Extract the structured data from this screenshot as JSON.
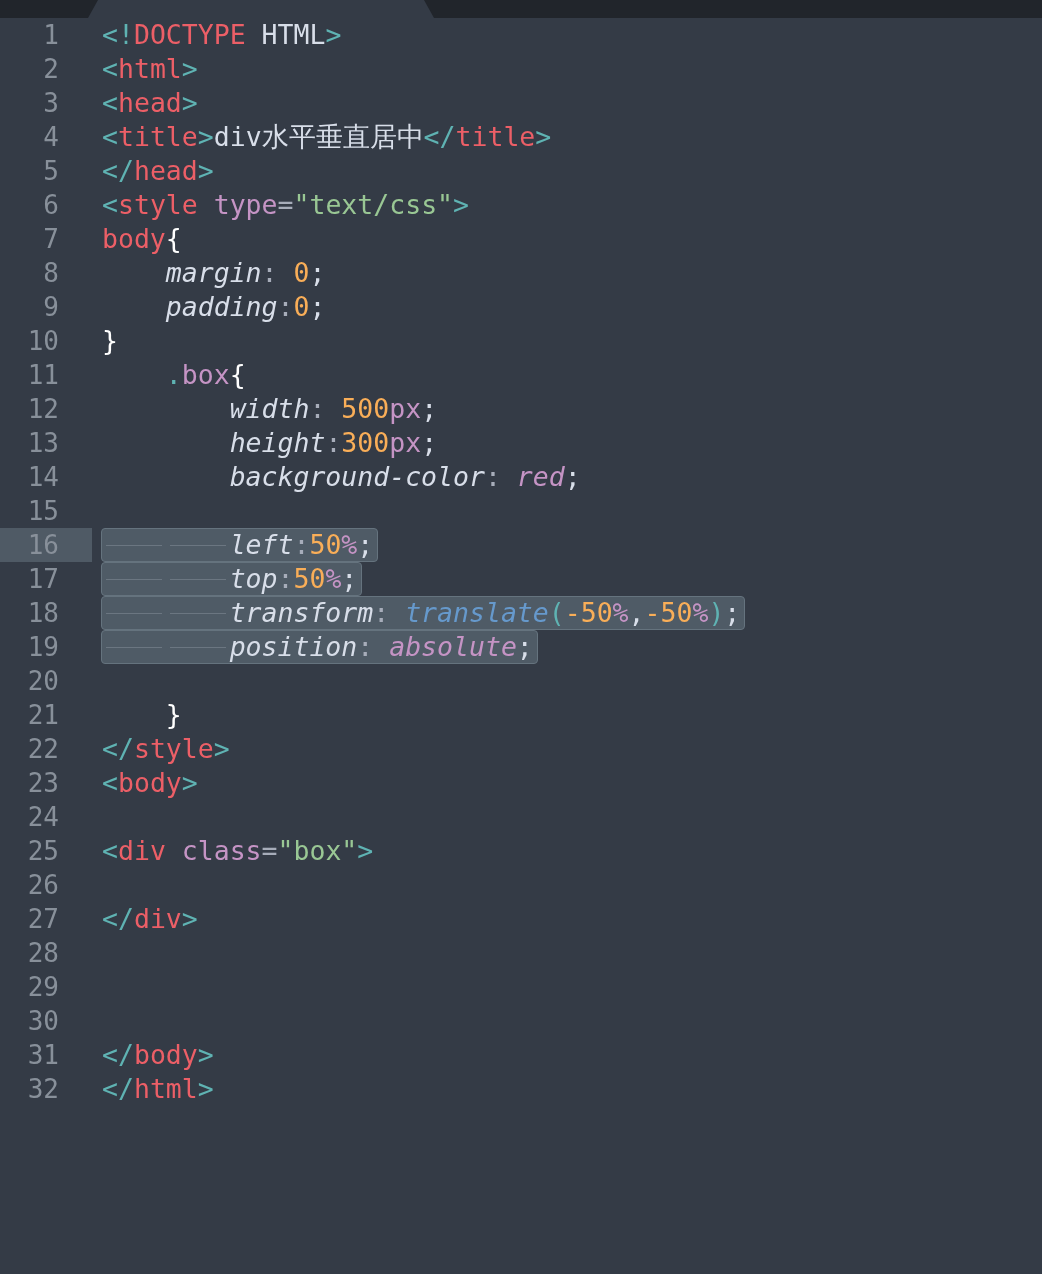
{
  "tab": {
    "selected": true
  },
  "lines": [
    {
      "number": "1",
      "selected": false,
      "current": false,
      "tokens": [
        {
          "text": "<!",
          "kind": "punct"
        },
        {
          "text": "DOCTYPE",
          "kind": "tag"
        },
        {
          "text": " HTML",
          "kind": "plain"
        },
        {
          "text": ">",
          "kind": "punct"
        }
      ]
    },
    {
      "number": "2",
      "selected": false,
      "current": false,
      "tokens": [
        {
          "text": "<",
          "kind": "punct"
        },
        {
          "text": "html",
          "kind": "tag"
        },
        {
          "text": ">",
          "kind": "punct"
        }
      ]
    },
    {
      "number": "3",
      "selected": false,
      "current": false,
      "tokens": [
        {
          "text": "<",
          "kind": "punct"
        },
        {
          "text": "head",
          "kind": "tag"
        },
        {
          "text": ">",
          "kind": "punct"
        }
      ]
    },
    {
      "number": "4",
      "selected": false,
      "current": false,
      "tokens": [
        {
          "text": "<",
          "kind": "punct"
        },
        {
          "text": "title",
          "kind": "tag"
        },
        {
          "text": ">",
          "kind": "punct"
        },
        {
          "text": "div水平垂直居中",
          "kind": "plain"
        },
        {
          "text": "</",
          "kind": "punct"
        },
        {
          "text": "title",
          "kind": "tag"
        },
        {
          "text": ">",
          "kind": "punct"
        }
      ]
    },
    {
      "number": "5",
      "selected": false,
      "current": false,
      "tokens": [
        {
          "text": "</",
          "kind": "punct"
        },
        {
          "text": "head",
          "kind": "tag"
        },
        {
          "text": ">",
          "kind": "punct"
        }
      ]
    },
    {
      "number": "6",
      "selected": false,
      "current": false,
      "tokens": [
        {
          "text": "<",
          "kind": "punct"
        },
        {
          "text": "style",
          "kind": "tag"
        },
        {
          "text": " type",
          "kind": "attr"
        },
        {
          "text": "=",
          "kind": "op"
        },
        {
          "text": "\"text/css\"",
          "kind": "string"
        },
        {
          "text": ">",
          "kind": "punct"
        }
      ]
    },
    {
      "number": "7",
      "selected": false,
      "current": false,
      "tokens": [
        {
          "text": "body",
          "kind": "tag"
        },
        {
          "text": "{",
          "kind": "brace"
        }
      ]
    },
    {
      "number": "8",
      "selected": false,
      "current": false,
      "tokens": [
        {
          "text": "    margin",
          "kind": "prop"
        },
        {
          "text": ": ",
          "kind": "op"
        },
        {
          "text": "0",
          "kind": "number"
        },
        {
          "text": ";",
          "kind": "semi"
        }
      ]
    },
    {
      "number": "9",
      "selected": false,
      "current": false,
      "tokens": [
        {
          "text": "    padding",
          "kind": "prop"
        },
        {
          "text": ":",
          "kind": "op"
        },
        {
          "text": "0",
          "kind": "number"
        },
        {
          "text": ";",
          "kind": "semi"
        }
      ]
    },
    {
      "number": "10",
      "selected": false,
      "current": false,
      "tokens": [
        {
          "text": "}",
          "kind": "brace"
        }
      ]
    },
    {
      "number": "11",
      "selected": false,
      "current": false,
      "tokens": [
        {
          "text": "    .",
          "kind": "punct"
        },
        {
          "text": "box",
          "kind": "attr"
        },
        {
          "text": "{",
          "kind": "brace"
        }
      ]
    },
    {
      "number": "12",
      "selected": false,
      "current": false,
      "tokens": [
        {
          "text": "        width",
          "kind": "prop"
        },
        {
          "text": ": ",
          "kind": "op"
        },
        {
          "text": "500",
          "kind": "number"
        },
        {
          "text": "px",
          "kind": "unit"
        },
        {
          "text": ";",
          "kind": "semi"
        }
      ]
    },
    {
      "number": "13",
      "selected": false,
      "current": false,
      "tokens": [
        {
          "text": "        height",
          "kind": "prop"
        },
        {
          "text": ":",
          "kind": "op"
        },
        {
          "text": "300",
          "kind": "number"
        },
        {
          "text": "px",
          "kind": "unit"
        },
        {
          "text": ";",
          "kind": "semi"
        }
      ]
    },
    {
      "number": "14",
      "selected": false,
      "current": false,
      "tokens": [
        {
          "text": "        background-color",
          "kind": "prop"
        },
        {
          "text": ": ",
          "kind": "op"
        },
        {
          "text": "red",
          "kind": "value"
        },
        {
          "text": ";",
          "kind": "semi"
        }
      ]
    },
    {
      "number": "15",
      "selected": false,
      "current": false
    },
    {
      "number": "16",
      "selected": true,
      "current": true,
      "tokens": [
        {
          "text": "        left",
          "kind": "prop"
        },
        {
          "text": ":",
          "kind": "op"
        },
        {
          "text": "50",
          "kind": "number"
        },
        {
          "text": "%",
          "kind": "unit"
        },
        {
          "text": ";",
          "kind": "semi"
        }
      ]
    },
    {
      "number": "17",
      "selected": true,
      "current": false,
      "tokens": [
        {
          "text": "        top",
          "kind": "prop"
        },
        {
          "text": ":",
          "kind": "op"
        },
        {
          "text": "50",
          "kind": "number"
        },
        {
          "text": "%",
          "kind": "unit"
        },
        {
          "text": ";",
          "kind": "semi"
        }
      ]
    },
    {
      "number": "18",
      "selected": true,
      "current": false,
      "tokens": [
        {
          "text": "        transform",
          "kind": "prop"
        },
        {
          "text": ": ",
          "kind": "op"
        },
        {
          "text": "translate",
          "kind": "func"
        },
        {
          "text": "(",
          "kind": "punct"
        },
        {
          "text": "-50",
          "kind": "number"
        },
        {
          "text": "%",
          "kind": "unit"
        },
        {
          "text": ",",
          "kind": "semi"
        },
        {
          "text": "-50",
          "kind": "number"
        },
        {
          "text": "%",
          "kind": "unit"
        },
        {
          "text": ")",
          "kind": "punct"
        },
        {
          "text": ";",
          "kind": "semi"
        }
      ]
    },
    {
      "number": "19",
      "selected": true,
      "current": false,
      "tokens": [
        {
          "text": "        position",
          "kind": "prop"
        },
        {
          "text": ": ",
          "kind": "op"
        },
        {
          "text": "absolute",
          "kind": "value"
        },
        {
          "text": ";",
          "kind": "semi"
        }
      ]
    },
    {
      "number": "20",
      "selected": false,
      "current": false
    },
    {
      "number": "21",
      "selected": false,
      "current": false,
      "tokens": [
        {
          "text": "    }",
          "kind": "brace"
        }
      ]
    },
    {
      "number": "22",
      "selected": false,
      "current": false,
      "tokens": [
        {
          "text": "</",
          "kind": "punct"
        },
        {
          "text": "style",
          "kind": "tag"
        },
        {
          "text": ">",
          "kind": "punct"
        }
      ]
    },
    {
      "number": "23",
      "selected": false,
      "current": false,
      "tokens": [
        {
          "text": "<",
          "kind": "punct"
        },
        {
          "text": "body",
          "kind": "tag"
        },
        {
          "text": ">",
          "kind": "punct"
        }
      ]
    },
    {
      "number": "24",
      "selected": false,
      "current": false
    },
    {
      "number": "25",
      "selected": false,
      "current": false,
      "tokens": [
        {
          "text": "<",
          "kind": "punct"
        },
        {
          "text": "div",
          "kind": "tag"
        },
        {
          "text": " class",
          "kind": "attr"
        },
        {
          "text": "=",
          "kind": "op"
        },
        {
          "text": "\"box\"",
          "kind": "string"
        },
        {
          "text": ">",
          "kind": "punct"
        }
      ]
    },
    {
      "number": "26",
      "selected": false,
      "current": false
    },
    {
      "number": "27",
      "selected": false,
      "current": false,
      "tokens": [
        {
          "text": "</",
          "kind": "punct"
        },
        {
          "text": "div",
          "kind": "tag"
        },
        {
          "text": ">",
          "kind": "punct"
        }
      ]
    },
    {
      "number": "28",
      "selected": false,
      "current": false
    },
    {
      "number": "29",
      "selected": false,
      "current": false
    },
    {
      "number": "30",
      "selected": false,
      "current": false
    },
    {
      "number": "31",
      "selected": false,
      "current": false,
      "tokens": [
        {
          "text": "</",
          "kind": "punct"
        },
        {
          "text": "body",
          "kind": "tag"
        },
        {
          "text": ">",
          "kind": "punct"
        }
      ]
    },
    {
      "number": "32",
      "selected": false,
      "current": false,
      "tokens": [
        {
          "text": "</",
          "kind": "punct"
        },
        {
          "text": "html",
          "kind": "tag"
        },
        {
          "text": ">",
          "kind": "punct"
        }
      ]
    }
  ]
}
